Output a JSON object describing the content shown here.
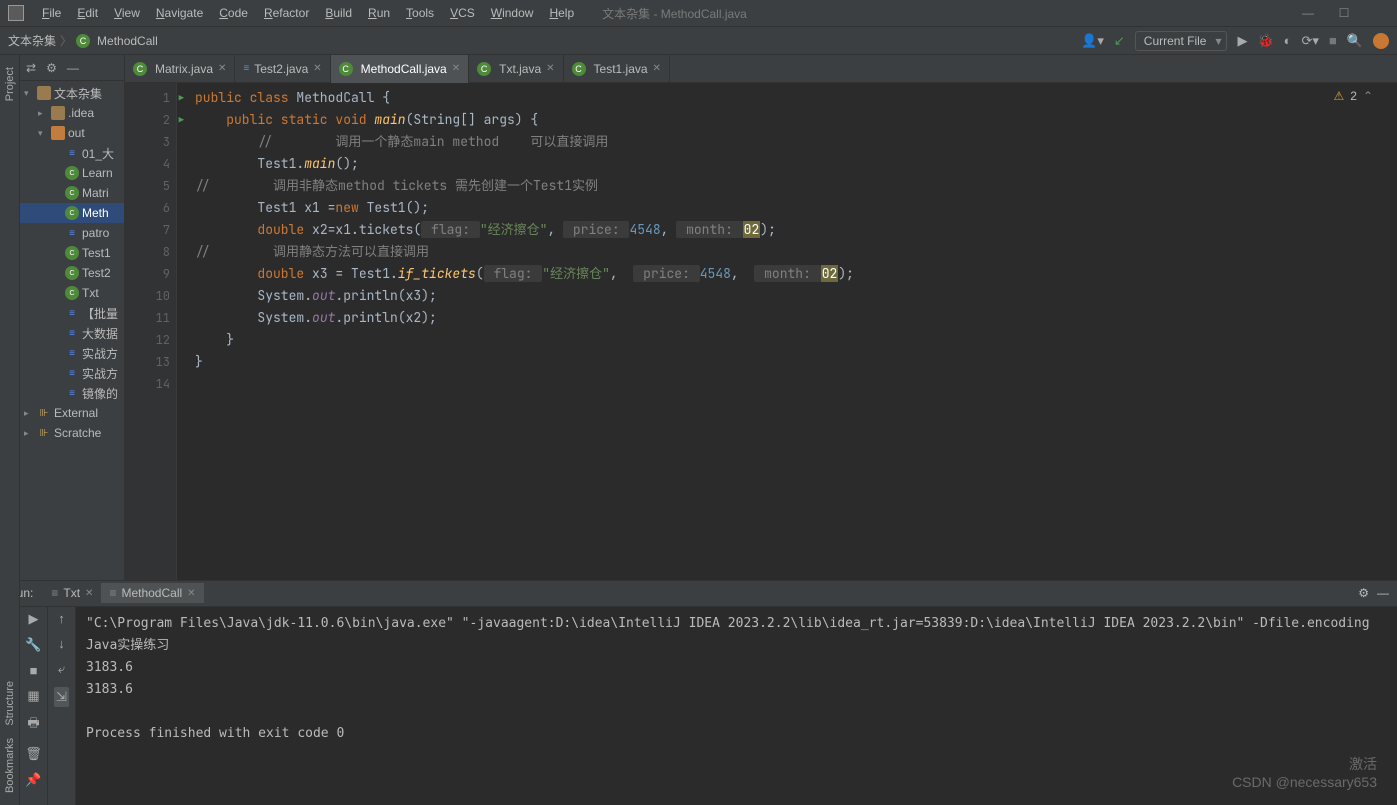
{
  "window": {
    "title": "文本杂集 - MethodCall.java"
  },
  "menu": [
    "File",
    "Edit",
    "View",
    "Navigate",
    "Code",
    "Refactor",
    "Build",
    "Run",
    "Tools",
    "VCS",
    "Window",
    "Help"
  ],
  "breadcrumb": {
    "root": "文本杂集",
    "file": "MethodCall"
  },
  "toolbar": {
    "run_config": "Current File"
  },
  "warnings": {
    "count": "2"
  },
  "project_tree": [
    {
      "indent": 0,
      "arrow": "▾",
      "icon": "folder",
      "label": "文本杂集"
    },
    {
      "indent": 1,
      "arrow": "▸",
      "icon": "folder",
      "label": ".idea"
    },
    {
      "indent": 1,
      "arrow": "▾",
      "icon": "folder-orange",
      "label": "out"
    },
    {
      "indent": 2,
      "arrow": "",
      "icon": "jfile",
      "label": "01_大"
    },
    {
      "indent": 2,
      "arrow": "",
      "icon": "cfile",
      "label": "Learn"
    },
    {
      "indent": 2,
      "arrow": "",
      "icon": "cfile",
      "label": "Matri"
    },
    {
      "indent": 2,
      "arrow": "",
      "icon": "cfile",
      "label": "Meth",
      "selected": true
    },
    {
      "indent": 2,
      "arrow": "",
      "icon": "jfile",
      "label": "patro"
    },
    {
      "indent": 2,
      "arrow": "",
      "icon": "cfile",
      "label": "Test1"
    },
    {
      "indent": 2,
      "arrow": "",
      "icon": "cfile",
      "label": "Test2"
    },
    {
      "indent": 2,
      "arrow": "",
      "icon": "cfile",
      "label": "Txt"
    },
    {
      "indent": 2,
      "arrow": "",
      "icon": "jfile",
      "label": "【批量"
    },
    {
      "indent": 2,
      "arrow": "",
      "icon": "jfile",
      "label": "大数据"
    },
    {
      "indent": 2,
      "arrow": "",
      "icon": "jfile",
      "label": "实战方"
    },
    {
      "indent": 2,
      "arrow": "",
      "icon": "jfile",
      "label": "实战方"
    },
    {
      "indent": 2,
      "arrow": "",
      "icon": "jfile",
      "label": "镜像的"
    },
    {
      "indent": 0,
      "arrow": "▸",
      "icon": "lib",
      "label": "External"
    },
    {
      "indent": 0,
      "arrow": "▸",
      "icon": "lib",
      "label": "Scratche"
    }
  ],
  "tabs": [
    {
      "icon": "c",
      "label": "Matrix.java"
    },
    {
      "icon": "j",
      "label": "Test2.java"
    },
    {
      "icon": "c",
      "label": "MethodCall.java",
      "active": true
    },
    {
      "icon": "c",
      "label": "Txt.java"
    },
    {
      "icon": "c",
      "label": "Test1.java"
    }
  ],
  "line_numbers": [
    "1",
    "2",
    "3",
    "4",
    "5",
    "6",
    "7",
    "8",
    "9",
    "10",
    "11",
    "12",
    "13",
    "14"
  ],
  "code": {
    "l1": {
      "a": "public class ",
      "b": "MethodCall ",
      "c": "{"
    },
    "l2": {
      "a": "    public static void ",
      "b": "main",
      "c": "(String[] args) {"
    },
    "l3": "        //        调用一个静态main method    可以直接调用",
    "l4": {
      "a": "        Test1.",
      "b": "main",
      "c": "();"
    },
    "l5": "//        调用非静态method tickets 需先创建一个Test1实例",
    "l6": {
      "a": "        Test1 x1 =",
      "b": "new ",
      "c": "Test1();"
    },
    "l7": {
      "a": "        double ",
      "b": "x2=x1.tickets(",
      "p1": " flag: ",
      "s1": "\"经济擦仓\"",
      "c1": ", ",
      "p2": " price: ",
      "n1": "4548",
      "c2": ", ",
      "p3": " month: ",
      "n2": "02",
      "e": ");"
    },
    "l8": "//        调用静态方法可以直接调用",
    "l9": {
      "a": "        double ",
      "b": "x3 = Test1.",
      "fn": "if_tickets",
      "c": "(",
      "p1": " flag: ",
      "s1": "\"经济擦仓\"",
      "c1": ",  ",
      "p2": " price: ",
      "n1": "4548",
      "c2": ",  ",
      "p3": " month: ",
      "n2": "02",
      "e": ");"
    },
    "l10": {
      "a": "        System.",
      "b": "out",
      "c": ".println(x3);"
    },
    "l11": {
      "a": "        System.",
      "b": "out",
      "c": ".println(x2);"
    },
    "l12": "    }",
    "l13": "}"
  },
  "run": {
    "label": "Run:",
    "tabs": [
      {
        "label": "Txt"
      },
      {
        "label": "MethodCall",
        "active": true
      }
    ],
    "output": [
      "\"C:\\Program Files\\Java\\jdk-11.0.6\\bin\\java.exe\" \"-javaagent:D:\\idea\\IntelliJ IDEA 2023.2.2\\lib\\idea_rt.jar=53839:D:\\idea\\IntelliJ IDEA 2023.2.2\\bin\" -Dfile.encoding",
      "Java实操练习",
      "3183.6",
      "3183.6",
      "",
      "Process finished with exit code 0"
    ]
  },
  "watermark": {
    "a": "激活",
    "b": "CSDN @necessary653"
  }
}
